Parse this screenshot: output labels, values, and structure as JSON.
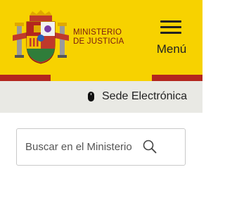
{
  "header": {
    "ministry_line1": "MINISTERIO",
    "ministry_line2": "DE JUSTICIA",
    "menu_label": "Menú",
    "background_color": "#f7d200",
    "stripe_color": "#b3261e",
    "logo_icon": "coat-of-arms-of-spain-icon"
  },
  "sede": {
    "label": "Sede Electrónica",
    "icon": "mouse-icon",
    "background_color": "#e9e9e4"
  },
  "search": {
    "placeholder": "Buscar en el Ministerio",
    "value": "",
    "icon": "search-icon"
  }
}
